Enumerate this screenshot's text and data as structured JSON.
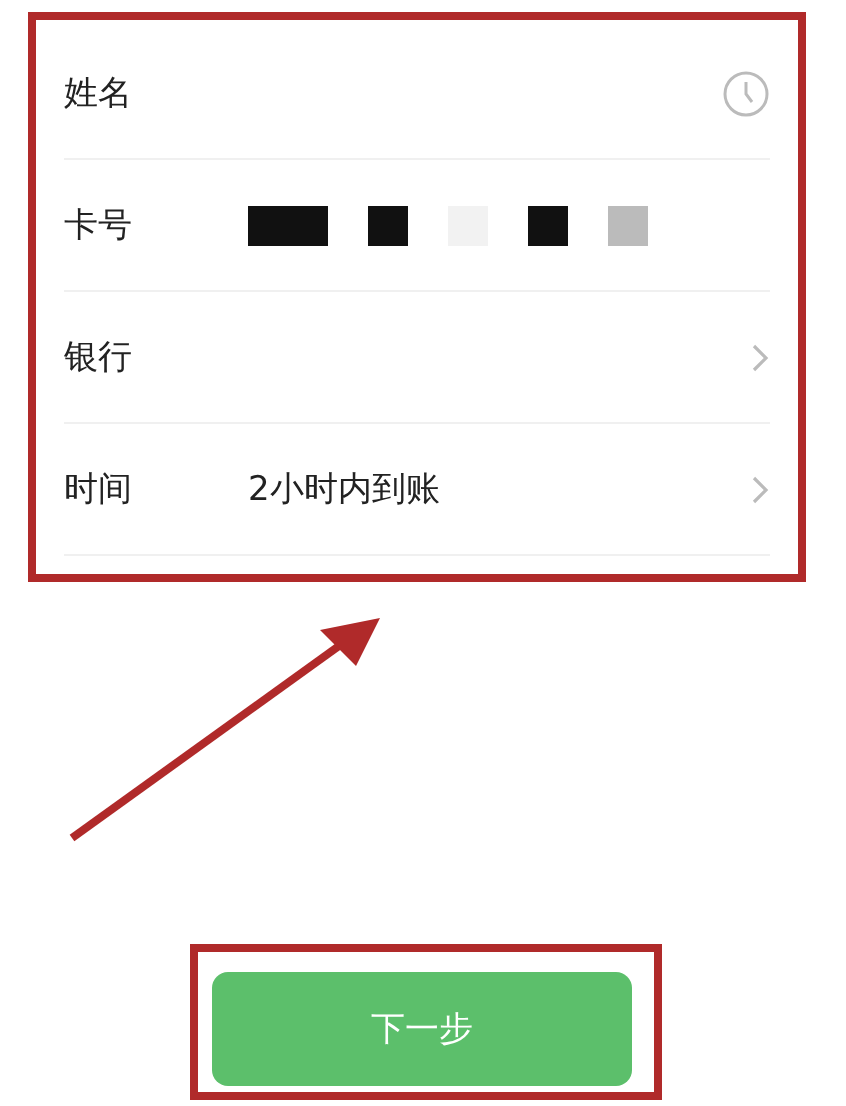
{
  "form": {
    "rows": [
      {
        "label": "姓名",
        "kind": "clock"
      },
      {
        "label": "卡号",
        "kind": "redacted"
      },
      {
        "label": "银行",
        "kind": "chevron"
      },
      {
        "label": "时间",
        "value": "2小时内到账",
        "kind": "chevron"
      }
    ]
  },
  "next_button": {
    "label": "下一步"
  }
}
